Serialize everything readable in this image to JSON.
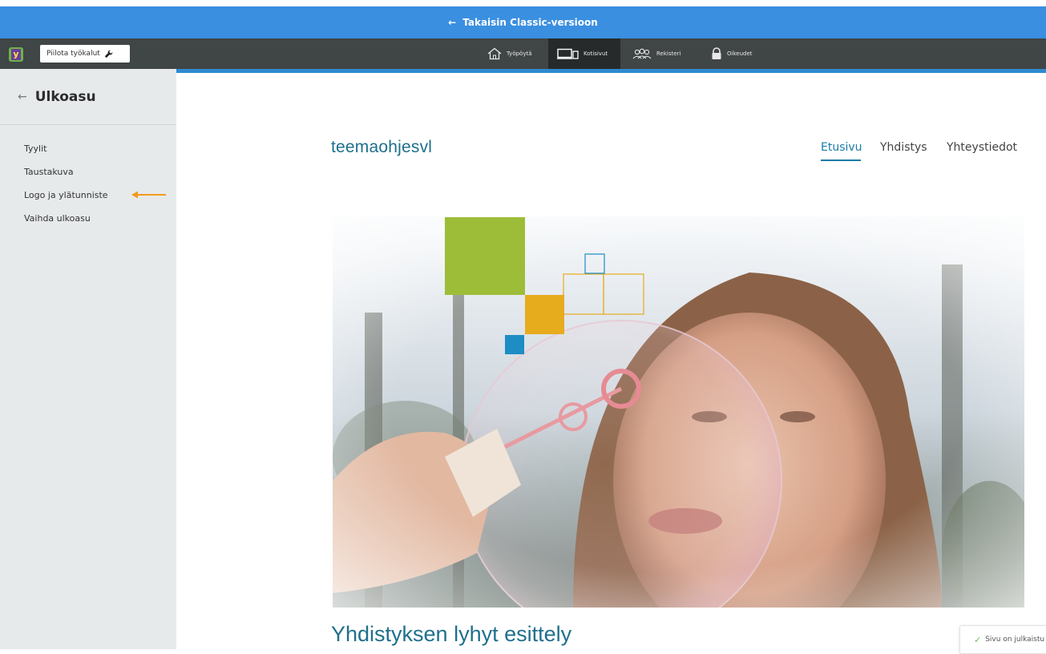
{
  "classic_bar": {
    "arrow": "←",
    "label": "Takaisin Classic-versioon"
  },
  "toolbar": {
    "hide_tools_label": "Piilota työkalut",
    "logo_letter": "y",
    "tabs": [
      {
        "label": "Työpöytä",
        "icon": "home-icon"
      },
      {
        "label": "Kotisivut",
        "icon": "monitor-icon",
        "active": true
      },
      {
        "label": "Rekisteri",
        "icon": "people-icon"
      },
      {
        "label": "Oikeudet",
        "icon": "lock-icon"
      }
    ]
  },
  "sidebar": {
    "back_arrow": "←",
    "title": "Ulkoasu",
    "items": [
      {
        "label": "Tyylit"
      },
      {
        "label": "Taustakuva"
      },
      {
        "label": "Logo ja ylätunniste"
      },
      {
        "label": "Vaihda ulkoasu"
      }
    ]
  },
  "site": {
    "logo_text": "teemaohjesvl",
    "nav": [
      {
        "label": "Etusivu",
        "active": true
      },
      {
        "label": "Yhdistys"
      },
      {
        "label": "Yhteystiedot"
      }
    ],
    "intro_heading": "Yhdistyksen lyhyt esittely"
  },
  "toast": {
    "label": "Sivu on julkaistu"
  },
  "colors": {
    "classic_bar": "#3a8fe0",
    "toolbar": "#404545",
    "accent": "#2f8ad0",
    "sidebar": "#e7eaeb",
    "brand_text": "#1f6f8c",
    "arrow": "#f39a1e",
    "deco_green": "#9dbd38",
    "deco_yellow": "#e7ab1e",
    "deco_blue": "#1d8dc4"
  }
}
